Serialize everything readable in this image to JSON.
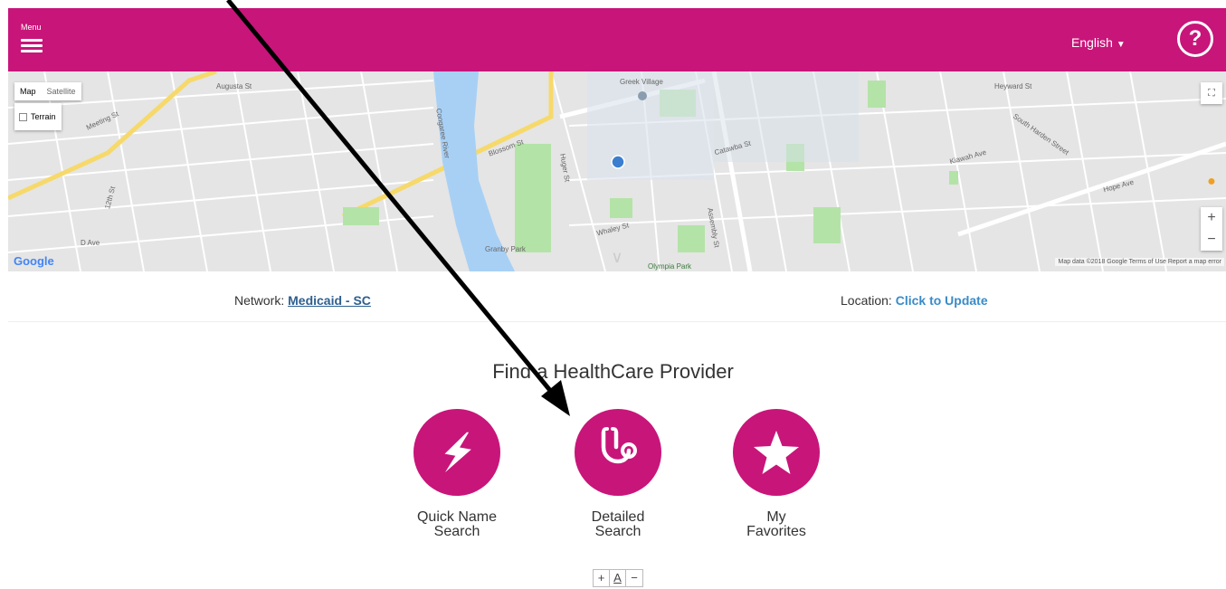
{
  "header": {
    "menu_label": "Menu",
    "menu_icon": "hamburger-icon",
    "language": "English",
    "help_icon": "?",
    "background_color": "#c8157a"
  },
  "map": {
    "map_tab": "Map",
    "satellite_tab": "Satellite",
    "terrain_label": "Terrain",
    "fullscreen_icon": "⛶",
    "zoom_in": "+",
    "zoom_out": "−",
    "pegman_icon": "person-icon",
    "google_logo": "Google",
    "footer": "Map data ©2018 Google   Terms of Use   Report a map error",
    "labels": {
      "greek_village": "Greek Village",
      "congaree_river": "Congaree River",
      "blossom_st": "Blossom St",
      "granby_park": "Granby Park",
      "olympia_park": "Olympia Park",
      "assembly_st": "Assembly St",
      "meeting_st": "Meeting St",
      "south_harden": "South Harden Street",
      "huger_st": "Huger St",
      "whaley_st": "Whaley St",
      "heyward_st": "Heyward St",
      "d_ave": "D Ave",
      "twelfth_st": "12th St",
      "augusta_st": "Augusta St",
      "hope_ave": "Hope Ave",
      "catawba_st": "Catawba St",
      "kiawah_ave": "Kiawah Ave"
    }
  },
  "info": {
    "network_label": "Network:",
    "network_value": "Medicaid - SC",
    "location_label": "Location:",
    "location_value": "Click to Update"
  },
  "main": {
    "title": "Find a HealthCare Provider",
    "tiles": [
      {
        "line1": "Quick Name",
        "line2": "Search",
        "icon": "lightning-icon"
      },
      {
        "line1": "Detailed",
        "line2": "Search",
        "icon": "stethoscope-icon"
      },
      {
        "line1": "My",
        "line2": "Favorites",
        "icon": "star-icon"
      }
    ],
    "font_tools": {
      "increase": "+",
      "reset": "A",
      "decrease": "−"
    }
  }
}
